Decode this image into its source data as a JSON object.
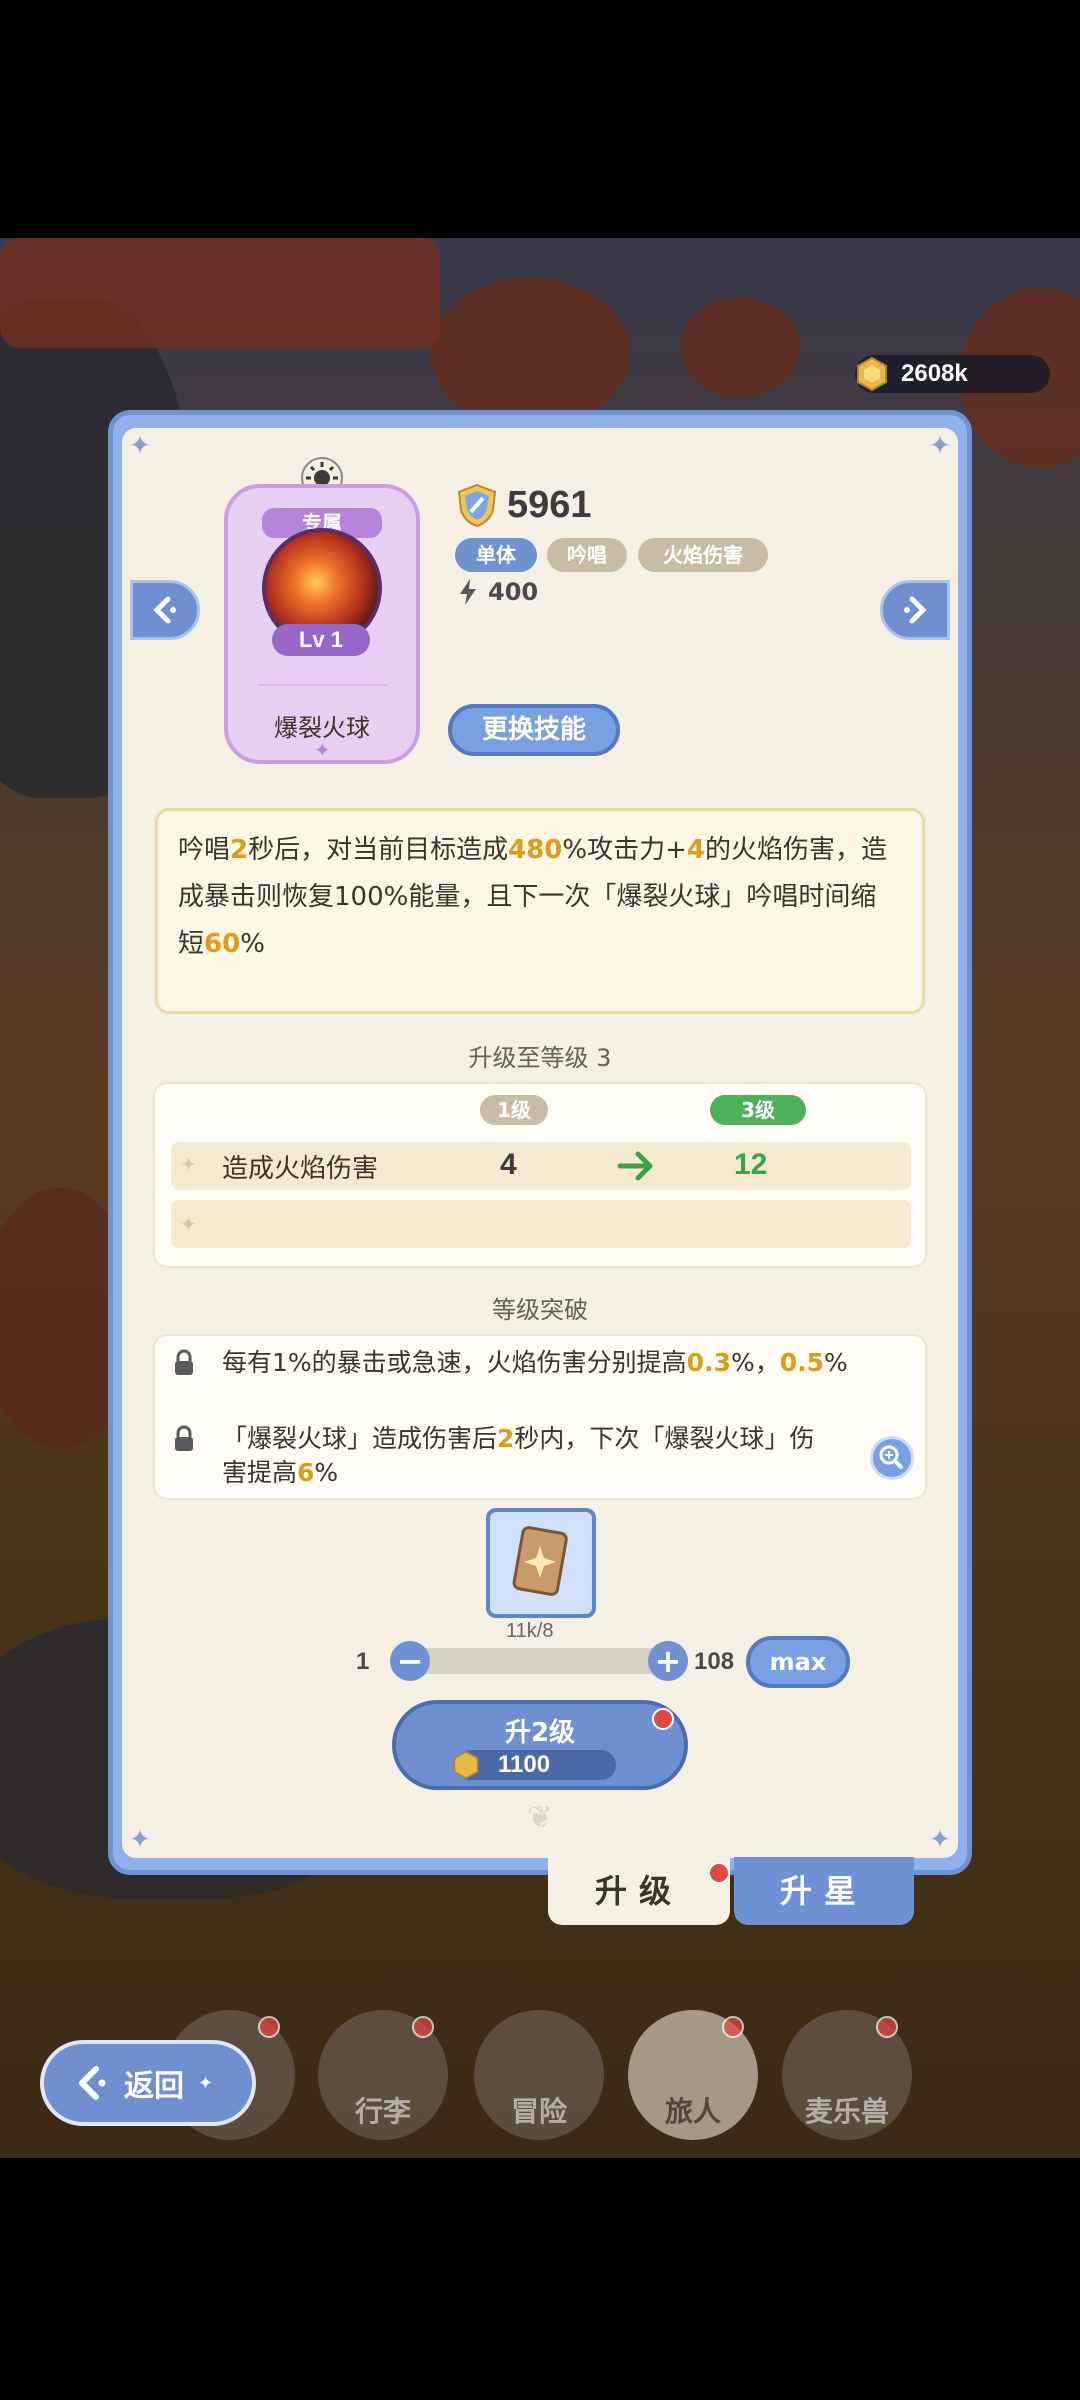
{
  "currency": {
    "amount": "2608k"
  },
  "skill": {
    "ribbon": "专属",
    "level": "Lv 1",
    "name": "爆裂火球",
    "power": "5961",
    "tags": [
      "单体",
      "吟唱",
      "火焰伤害"
    ],
    "energy_cost": "400",
    "change_button": "更换技能"
  },
  "description": {
    "segments": [
      {
        "t": "吟唱",
        "h": false
      },
      {
        "t": "2",
        "h": true
      },
      {
        "t": "秒后，对当前目标造成",
        "h": false
      },
      {
        "t": "480",
        "h": true
      },
      {
        "t": "%攻击力+",
        "h": false
      },
      {
        "t": "4",
        "h": true
      },
      {
        "t": "的火焰伤害，造成暴击则恢复100%能量，且下一次「爆裂火球」吟唱时间缩短",
        "h": false
      },
      {
        "t": "60",
        "h": true
      },
      {
        "t": "%",
        "h": false
      }
    ]
  },
  "upgrade": {
    "title": "升级至等级 3",
    "from_level": "1级",
    "to_level": "3级",
    "row_label": "造成火焰伤害",
    "from_value": "4",
    "to_value": "12"
  },
  "breakthrough": {
    "title": "等级突破",
    "line1": [
      {
        "t": "每有1%的暴击或急速，火焰伤害分别提高",
        "h": false
      },
      {
        "t": "0.3",
        "h": true
      },
      {
        "t": "%，",
        "h": false
      },
      {
        "t": "0.5",
        "h": true
      },
      {
        "t": "%",
        "h": false
      }
    ],
    "line2": [
      {
        "t": "「爆裂火球」造成伤害后",
        "h": false
      },
      {
        "t": "2",
        "h": true
      },
      {
        "t": "秒内，下次「爆裂火球」伤害提高",
        "h": false
      },
      {
        "t": "6",
        "h": true
      },
      {
        "t": "%",
        "h": false
      }
    ]
  },
  "material": {
    "count": "11k/8"
  },
  "quantity": {
    "min": "1",
    "max_value": "108",
    "max_label": "max",
    "selected_fraction": 0.0
  },
  "level_up_button": {
    "label": "升2级",
    "cost": "1100"
  },
  "tabs": {
    "upgrade": "升级",
    "star": "升星"
  },
  "bottom_nav": [
    "行李",
    "冒险",
    "旅人",
    "麦乐兽"
  ],
  "back_button": "返回",
  "colors": {
    "highlight": "#e09a15",
    "green": "#3aa24a",
    "accent_blue": "#7aa0e4"
  }
}
